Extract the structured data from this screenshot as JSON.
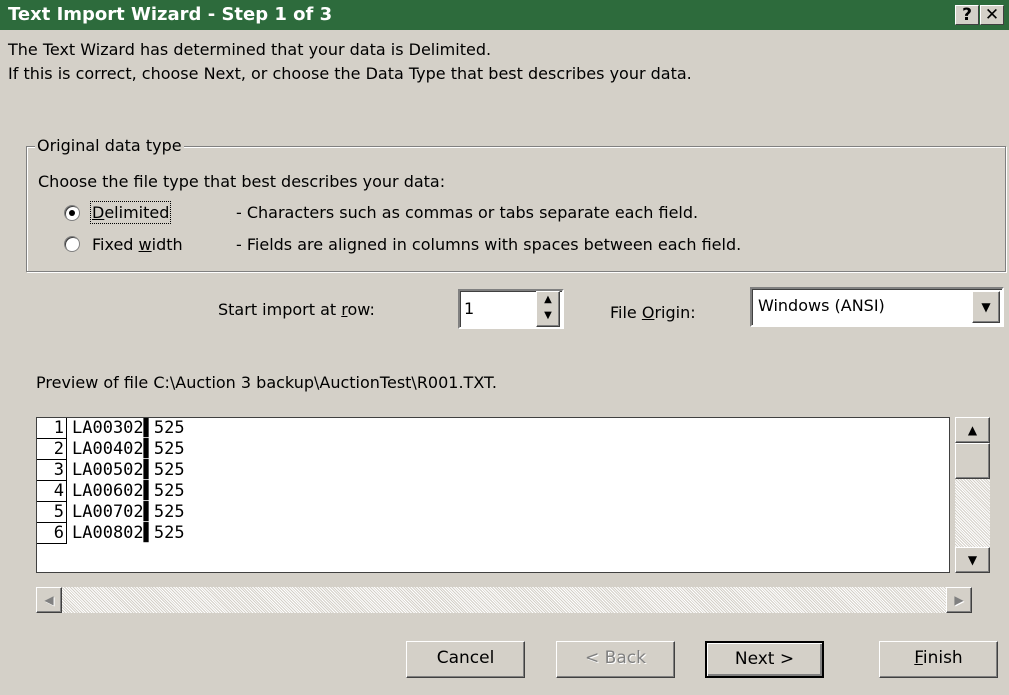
{
  "window": {
    "title": "Text Import Wizard - Step 1 of 3",
    "help_glyph": "?",
    "close_glyph": "✕"
  },
  "intro": {
    "line1": "The Text Wizard has determined that your data is Delimited.",
    "line2": "If this is correct, choose Next, or choose the Data Type that best describes your data."
  },
  "data_type": {
    "group_label": "Original data type",
    "prompt": "Choose the file type that best describes your data:",
    "options": [
      {
        "label_pre": "",
        "label_key": "D",
        "label_post": "elimited",
        "desc": "- Characters such as commas or tabs separate each field.",
        "selected": true
      },
      {
        "label_pre": "Fixed ",
        "label_key": "w",
        "label_post": "idth",
        "desc": "- Fields are aligned in columns with spaces between each field.",
        "selected": false
      }
    ]
  },
  "start_row": {
    "label_pre": "Start import at ",
    "label_key": "r",
    "label_post": "ow:",
    "value": "1"
  },
  "file_origin": {
    "label_pre": "File ",
    "label_key": "O",
    "label_post": "rigin:",
    "value": "Windows (ANSI)"
  },
  "preview": {
    "label": "Preview of file C:\\Auction 3 backup\\AuctionTest\\R001.TXT.",
    "rows": [
      {
        "num": "1",
        "text": "LA00302▌525"
      },
      {
        "num": "2",
        "text": "LA00402▌525"
      },
      {
        "num": "3",
        "text": "LA00502▌525"
      },
      {
        "num": "4",
        "text": "LA00602▌525"
      },
      {
        "num": "5",
        "text": "LA00702▌525"
      },
      {
        "num": "6",
        "text": "LA00802▌525"
      }
    ]
  },
  "buttons": {
    "cancel": "Cancel",
    "back": "< Back",
    "next": "Next >",
    "finish_key": "F",
    "finish_rest": "inish"
  },
  "colors": {
    "titlebar": "#2d6b3c",
    "face": "#d4d0c8"
  }
}
